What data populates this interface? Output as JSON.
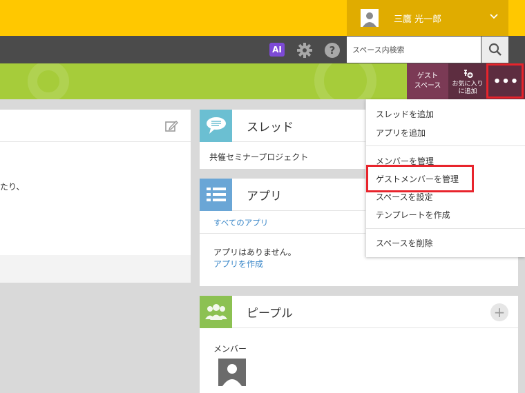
{
  "header": {
    "user_name": "三鷹 光一郎"
  },
  "toolbar": {
    "ai_label": "AI",
    "help_label": "?",
    "search_placeholder": "スペース内検索"
  },
  "space_actions": {
    "guest_space_line1": "ゲスト",
    "guest_space_line2": "スペース",
    "favorite_line1": "お気に入り",
    "favorite_line2": "に追加",
    "more_label": "•••"
  },
  "left_card": {
    "text": "たり、"
  },
  "thread_card": {
    "title": "スレッド",
    "item": "共催セミナープロジェクト"
  },
  "app_card": {
    "title": "アプリ",
    "all_apps_link": "すべてのアプリ",
    "empty_text": "アプリはありません。",
    "create_link": "アプリを作成"
  },
  "people_card": {
    "title": "ピープル",
    "add_label": "+",
    "members_label": "メンバー"
  },
  "menu": {
    "items": [
      "スレッドを追加",
      "アプリを追加",
      "メンバーを管理",
      "ゲストメンバーを管理",
      "スペースを設定",
      "テンプレートを作成",
      "スペースを削除"
    ]
  },
  "colors": {
    "header_yellow": "#ffc800",
    "space_green": "#a6cc3a",
    "highlight_red": "#e8242c",
    "link_blue": "#3a87c8"
  }
}
